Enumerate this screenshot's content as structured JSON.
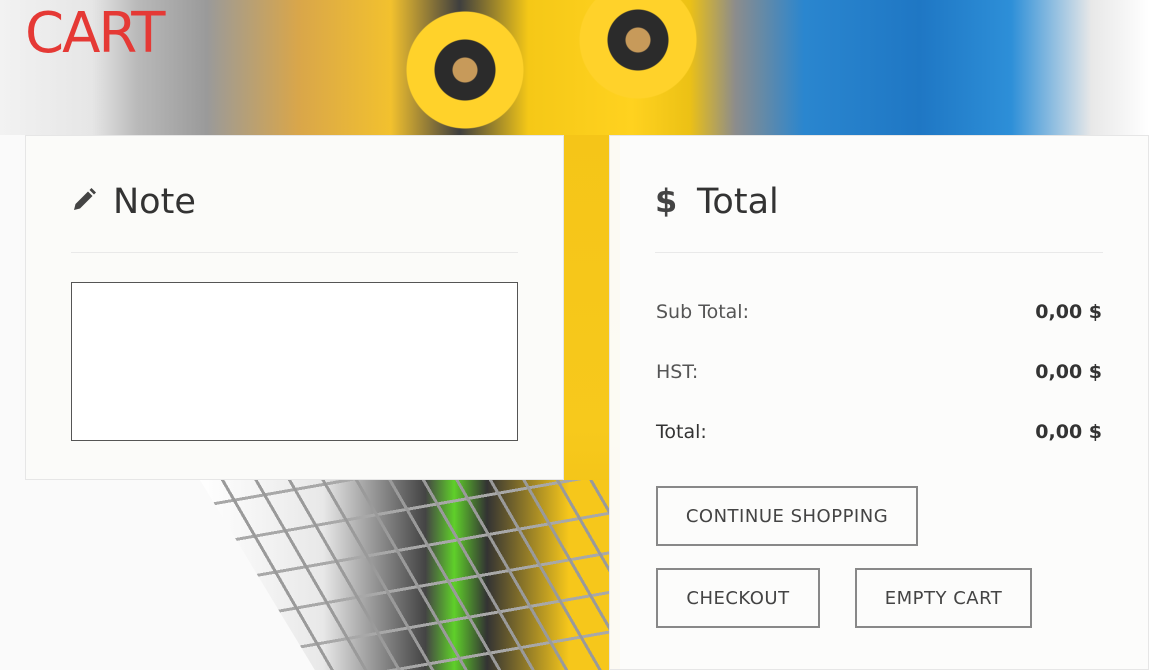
{
  "page": {
    "title": "CART"
  },
  "note": {
    "heading": "Note",
    "icon": "pencil-icon",
    "textarea_value": ""
  },
  "totals": {
    "heading": "Total",
    "icon": "dollar-icon",
    "rows": [
      {
        "label": "Sub Total:",
        "value": "0,00 $"
      },
      {
        "label": "HST:",
        "value": "0,00 $"
      },
      {
        "label": "Total:",
        "value": "0,00 $"
      }
    ]
  },
  "buttons": {
    "continue_shopping": "CONTINUE SHOPPING",
    "checkout": "CHECKOUT",
    "empty_cart": "EMPTY CART"
  },
  "colors": {
    "title": "#e53935",
    "panel_bg": "#fbfbf9",
    "button_border": "#888888"
  }
}
